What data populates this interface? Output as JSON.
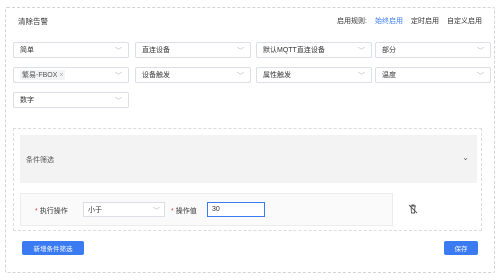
{
  "header": {
    "title": "清除告警",
    "rules_label": "启用规则:",
    "rules": [
      {
        "label": "始终启用",
        "active": true
      },
      {
        "label": "定时启用",
        "active": false
      },
      {
        "label": "自定义启用",
        "active": false
      }
    ]
  },
  "rows": [
    [
      "简单",
      "直连设备",
      "默认MQTT直连设备",
      "部分"
    ],
    [
      "设备触发",
      "属性触发",
      "温度"
    ]
  ],
  "selected_device_tag": "繁易-FBOX",
  "data_type": "数字",
  "condition_panel": {
    "title": "条件筛选",
    "operation_label": "执行操作",
    "operation_value": "小于",
    "value_label": "操作值",
    "value_input": "30"
  },
  "buttons": {
    "add_condition": "新增条件筛选",
    "save": "保存"
  },
  "icons": {
    "dropdown": "chevron-down-icon",
    "remove_tag": "close-icon",
    "delete": "trash-icon",
    "collapse": "chevron-down-icon"
  },
  "colors": {
    "accent": "#3a7bf2",
    "required": "#e03c3c"
  }
}
